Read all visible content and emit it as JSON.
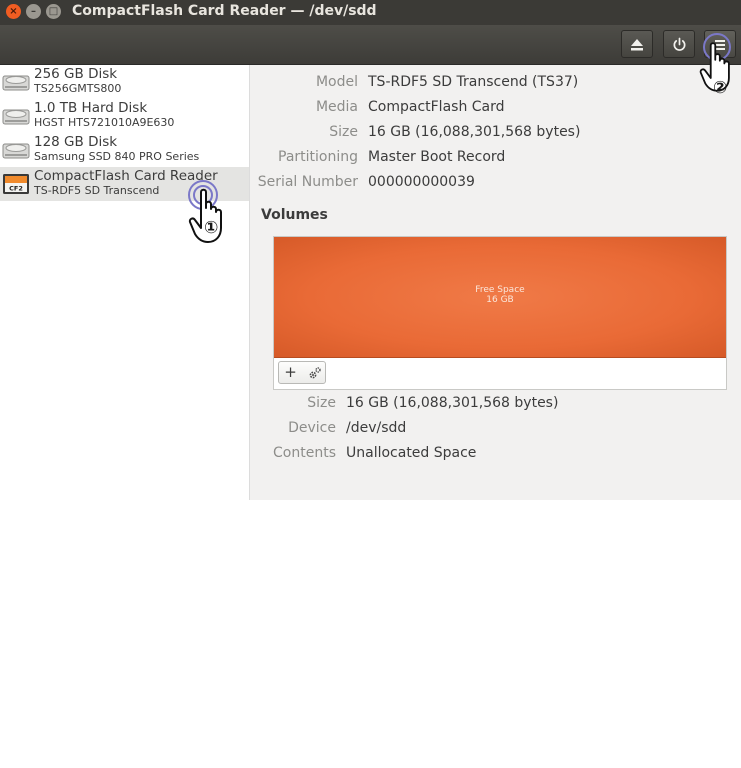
{
  "window": {
    "title": "CompactFlash Card Reader — /dev/sdd",
    "controls": {
      "close": "×",
      "minimize": "–",
      "maximize": "□"
    }
  },
  "header": {
    "eject_icon": "eject-icon",
    "power_icon": "power-icon",
    "menu_icon": "hamburger-menu-icon"
  },
  "sidebar": {
    "drives": [
      {
        "name": "256 GB Disk",
        "subtitle": "TS256GMTS800",
        "icon": "hard-disk-icon"
      },
      {
        "name": "1.0 TB Hard Disk",
        "subtitle": "HGST HTS721010A9E630",
        "icon": "hard-disk-icon"
      },
      {
        "name": "128 GB Disk",
        "subtitle": "Samsung SSD 840 PRO Series",
        "icon": "hard-disk-icon"
      },
      {
        "name": "CompactFlash Card Reader",
        "subtitle": "TS-RDF5 SD  Transcend",
        "icon": "compactflash-icon",
        "badge": "CF2"
      }
    ]
  },
  "details": {
    "model_label": "Model",
    "model_value": "TS-RDF5 SD  Transcend (TS37)",
    "media_label": "Media",
    "media_value": "CompactFlash Card",
    "size_label": "Size",
    "size_value": "16 GB (16,088,301,568 bytes)",
    "partitioning_label": "Partitioning",
    "partitioning_value": "Master Boot Record",
    "serial_label": "Serial Number",
    "serial_value": "000000000039"
  },
  "volumes": {
    "title": "Volumes",
    "segment_label": "Free Space",
    "segment_size": "16 GB",
    "add_label": "+",
    "settings_icon": "gears-icon",
    "size_label": "Size",
    "size_value": "16 GB (16,088,301,568 bytes)",
    "device_label": "Device",
    "device_value": "/dev/sdd",
    "contents_label": "Contents",
    "contents_value": "Unallocated Space"
  },
  "annotations": {
    "step1": "①",
    "step2": "②"
  },
  "colors": {
    "accent": "#e96a36",
    "titlebar": "#3b3a36",
    "sidebar_selected": "#e4e4e2"
  }
}
